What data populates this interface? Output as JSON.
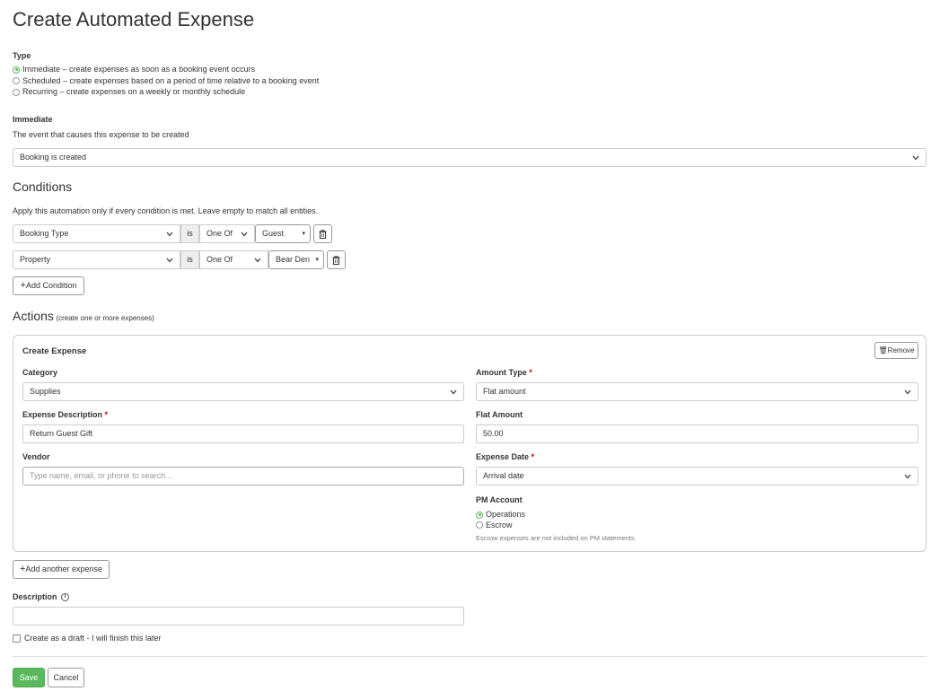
{
  "page_title": "Create Automated Expense",
  "type": {
    "label": "Type",
    "options": [
      {
        "label": "Immediate – create expenses as soon as a booking event occurs",
        "selected": true
      },
      {
        "label": "Scheduled – create expenses based on a period of time relative to a booking event",
        "selected": false
      },
      {
        "label": "Recurring – create expenses on a weekly or monthly schedule",
        "selected": false
      }
    ]
  },
  "immediate": {
    "label": "Immediate",
    "help": "The event that causes this expense to be created",
    "event_value": "Booking is created"
  },
  "conditions": {
    "title": "Conditions",
    "help": "Apply this automation only if every condition is met. Leave empty to match all entities.",
    "rows": [
      {
        "field": "Booking Type",
        "op_label": "is",
        "match": "One Of",
        "value": "Guest"
      },
      {
        "field": "Property",
        "op_label": "is",
        "match": "One Of",
        "value": "Bear Den"
      }
    ],
    "add_label": "Add Condition"
  },
  "actions": {
    "title": "Actions",
    "subtitle": "(create one or more expenses)",
    "card": {
      "title": "Create Expense",
      "remove_label": "Remove",
      "category_label": "Category",
      "category_value": "Supplies",
      "amount_type_label": "Amount Type",
      "amount_type_value": "Flat amount",
      "description_label": "Expense Description",
      "description_value": "Return Guest Gift",
      "flat_amount_label": "Flat Amount",
      "flat_amount_value": "50.00",
      "vendor_label": "Vendor",
      "vendor_placeholder": "Type name, email, or phone to search...",
      "expense_date_label": "Expense Date",
      "expense_date_value": "Arrival date",
      "pm_account_label": "PM Account",
      "pm_options": [
        {
          "label": "Operations",
          "selected": true
        },
        {
          "label": "Escrow",
          "selected": false
        }
      ],
      "pm_note": "Escrow expenses are not included on PM statements",
      "required_mark": "*"
    },
    "add_label": "Add another expense"
  },
  "description": {
    "label": "Description",
    "value": ""
  },
  "draft_label": "Create as a draft - I will finish this later",
  "save_label": "Save",
  "cancel_label": "Cancel",
  "colors": {
    "accent": "#5cb85c",
    "required": "#cc0000",
    "border": "#cccccc"
  }
}
